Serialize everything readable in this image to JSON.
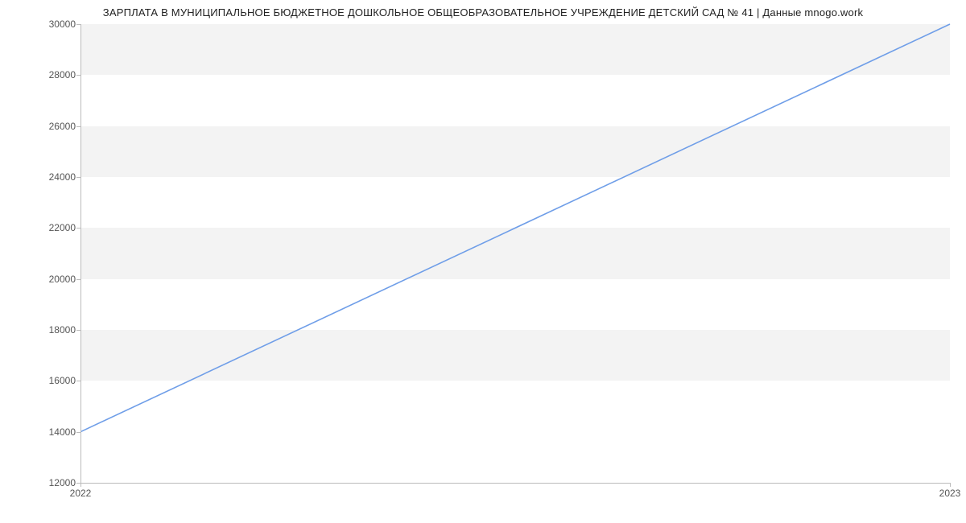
{
  "chart_data": {
    "type": "line",
    "title": "ЗАРПЛАТА В МУНИЦИПАЛЬНОЕ БЮДЖЕТНОЕ ДОШКОЛЬНОЕ ОБЩЕОБРАЗОВАТЕЛЬНОЕ УЧРЕЖДЕНИЕ ДЕТСКИЙ САД № 41 | Данные mnogo.work",
    "x": [
      2022,
      2023
    ],
    "series": [
      {
        "name": "salary",
        "values": [
          14000,
          30000
        ],
        "color": "#6f9ee8"
      }
    ],
    "xlabel": "",
    "ylabel": "",
    "ylim": [
      12000,
      30000
    ],
    "xlim": [
      2022,
      2023
    ],
    "yticks": [
      12000,
      14000,
      16000,
      18000,
      20000,
      22000,
      24000,
      26000,
      28000,
      30000
    ],
    "xticks": [
      2022,
      2023
    ],
    "grid": {
      "bands": true
    }
  }
}
